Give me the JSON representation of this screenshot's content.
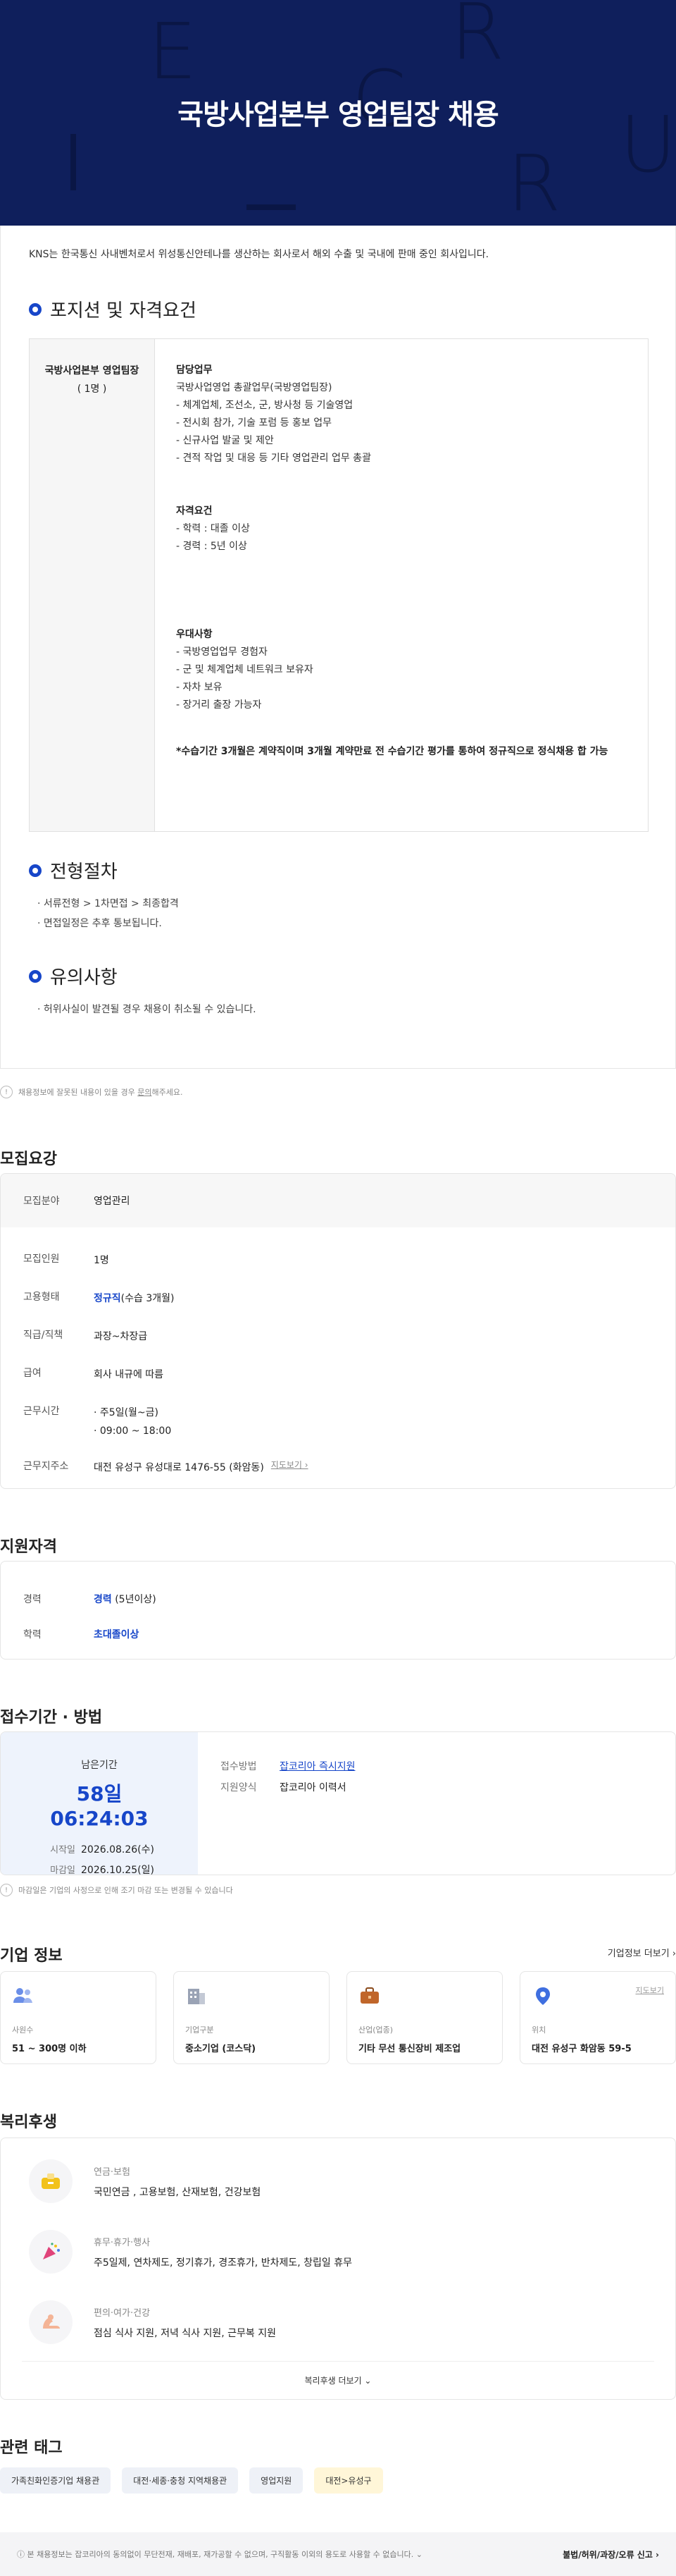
{
  "banner": {
    "title": "국방사업본부 영업팀장  채용"
  },
  "detail": {
    "intro": "KNS는 한국통신 사내벤처로서 위성통신안테나를 생산하는 회사로서 해외 수출 및 국내에 판매 중인 회사입니다.",
    "position_title": "포지션 및 자격요건",
    "position_name": "국방사업본부 영업팀장",
    "position_count": "( 1명 )",
    "duties_heading": "담당업무",
    "duties": [
      "국방사업영업 총괄업무(국방영업팀장)",
      "- 체계업체, 조선소, 군, 방사청 등 기술영업",
      "- 전시회 참가, 기술 포럼 등 홍보 업무",
      "- 신규사업 발굴 및 제안",
      "- 견적 작업 및 대응 등 기타 영업관리 업무 총괄"
    ],
    "qual_heading": "자격요건",
    "qualifications": [
      "- 학력 : 대졸 이상",
      "- 경력 : 5년 이상"
    ],
    "pref_heading": "우대사항",
    "preferences": [
      "-  국방영업업무 경험자",
      "- 군 및 체계업체 네트워크 보유자",
      "- 자차 보유",
      "- 장거리 출장 가능자"
    ],
    "note": "*수습기간 3개월은 계약직이며 3개월 계약만료 전 수습기간 평가를 통하여 정규직으로 정식채용 합 가능",
    "process_title": "전형절차",
    "process": [
      "서류전형 > 1차면접 > 최종합격",
      "면접일정은 추후 통보됩니다."
    ],
    "caution_title": "유의사항",
    "cautions": [
      "허위사실이 발견될 경우 채용이 취소될 수 있습니다."
    ]
  },
  "report_note": {
    "icon": "info-icon",
    "text": "채용정보에 잘못된 내용이 있을 경우 ",
    "link": "문의",
    "tail": "해주세요."
  },
  "recruit": {
    "heading": "모집요강",
    "field_label": "모집분야",
    "field_value": "영업관리",
    "rows": [
      {
        "label": "모집인원",
        "value": "1명"
      },
      {
        "label": "고용형태",
        "value_blue": "정규직",
        "value": "(수습 3개월)"
      },
      {
        "label": "직급/직책",
        "value": "과장~차장급"
      },
      {
        "label": "급여",
        "value": "회사 내규에 따름"
      }
    ],
    "hours_label": "근무시간",
    "hours": [
      "· 주5일(월~금)",
      "· 09:00 ~ 18:00"
    ],
    "addr_label": "근무지주소",
    "addr": "대전 유성구 유성대로 1476-55 (화암동)",
    "map_link": "지도보기"
  },
  "qualification": {
    "heading": "지원자격",
    "rows": [
      {
        "label": "경력",
        "value_blue": "경력",
        "value": " (5년이상)"
      },
      {
        "label": "학력",
        "value_blue": "초대졸이상",
        "value": ""
      }
    ]
  },
  "period": {
    "heading": "접수기간 · 방법",
    "remain_label": "남은기간",
    "remain": "58일 06:24:03",
    "start_label": "시작일",
    "start": "2026.08.26(수)",
    "end_label": "마감일",
    "end": "2026.10.25(일)",
    "method_label": "접수방법",
    "method": "잡코리아 즉시지원",
    "form_label": "지원양식",
    "form": "잡코리아 이력서",
    "note": "마감일은 기업의 사정으로 인해 조기 마감 또는 변경될 수 있습니다"
  },
  "company": {
    "heading": "기업 정보",
    "more": "기업정보 더보기",
    "cards": [
      {
        "icon": "people-icon",
        "label": "사원수",
        "value": "51 ~ 300명 이하"
      },
      {
        "icon": "building-icon",
        "label": "기업구분",
        "value": "중소기업 (코스닥)"
      },
      {
        "icon": "briefcase-icon",
        "label": "산업(업종)",
        "value": "기타 무선 통신장비 제조업"
      },
      {
        "icon": "location-icon",
        "label": "위치",
        "value": "대전 유성구 화암동 59-5",
        "map": "지도보기"
      }
    ]
  },
  "welfare": {
    "heading": "복리후생",
    "items": [
      {
        "icon": "piggy-bank-icon",
        "label": "연금·보험",
        "value": "국민연금 , 고용보험, 산재보험, 건강보험"
      },
      {
        "icon": "party-popper-icon",
        "label": "휴무·휴가·행사",
        "value": "주5일제, 연차제도, 정기휴가, 경조휴가, 반차제도, 창립일 휴무"
      },
      {
        "icon": "flexed-arm-icon",
        "label": "편의·여가·건강",
        "value": "점심 식사 지원, 저녁 식사 지원, 근무복 지원"
      }
    ],
    "more": "복리후생 더보기"
  },
  "tags": {
    "heading": "관련 태그",
    "items": [
      "가족친화인증기업 채용관",
      "대전·세종·충청 지역채용관",
      "영업지원",
      "대전>유성구"
    ]
  },
  "footer": {
    "notice": "본 채용정보는 잡코리아의 동의없이 무단전재, 재배포, 재가공할 수 없으며, 구직활동 이외의 용도로 사용할 수 없습니다.",
    "report": "불법/허위/과장/오류 신고"
  },
  "colors": {
    "navy": "#0f1f5c",
    "accent": "#1746c9"
  }
}
